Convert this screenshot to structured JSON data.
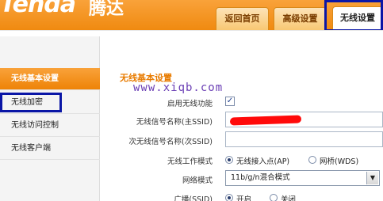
{
  "header": {
    "logo_text": "Tenda",
    "logo_cn": "腾达",
    "tabs": [
      {
        "label": "返回首页"
      },
      {
        "label": "高级设置"
      },
      {
        "label": "无线设置"
      }
    ]
  },
  "sidebar": {
    "items": [
      {
        "label": "无线基本设置"
      },
      {
        "label": "无线加密"
      },
      {
        "label": "无线访问控制"
      },
      {
        "label": "无线客户端"
      }
    ]
  },
  "main": {
    "title": "无线基本设置",
    "watermark": "www.xiqb.com",
    "enable_wireless_label": "启用无线功能",
    "ssid_label": "无线信号名称(主SSID)",
    "ssid2_label": "次无线信号名称(次SSID)",
    "ssid2_value": "",
    "work_mode_label": "无线工作模式",
    "work_mode_options": [
      "无线接入点(AP)",
      "网桥(WDS)"
    ],
    "net_mode_label": "网络模式",
    "net_mode_value": "11b/g/n混合模式",
    "broadcast_label": "广播(SSID)",
    "broadcast_options": [
      "开启",
      "关闭"
    ]
  },
  "colors": {
    "accent": "#f08a10",
    "highlight_box": "#0a16a6",
    "redaction": "#ff0a0a",
    "section_title": "#e87b00"
  }
}
